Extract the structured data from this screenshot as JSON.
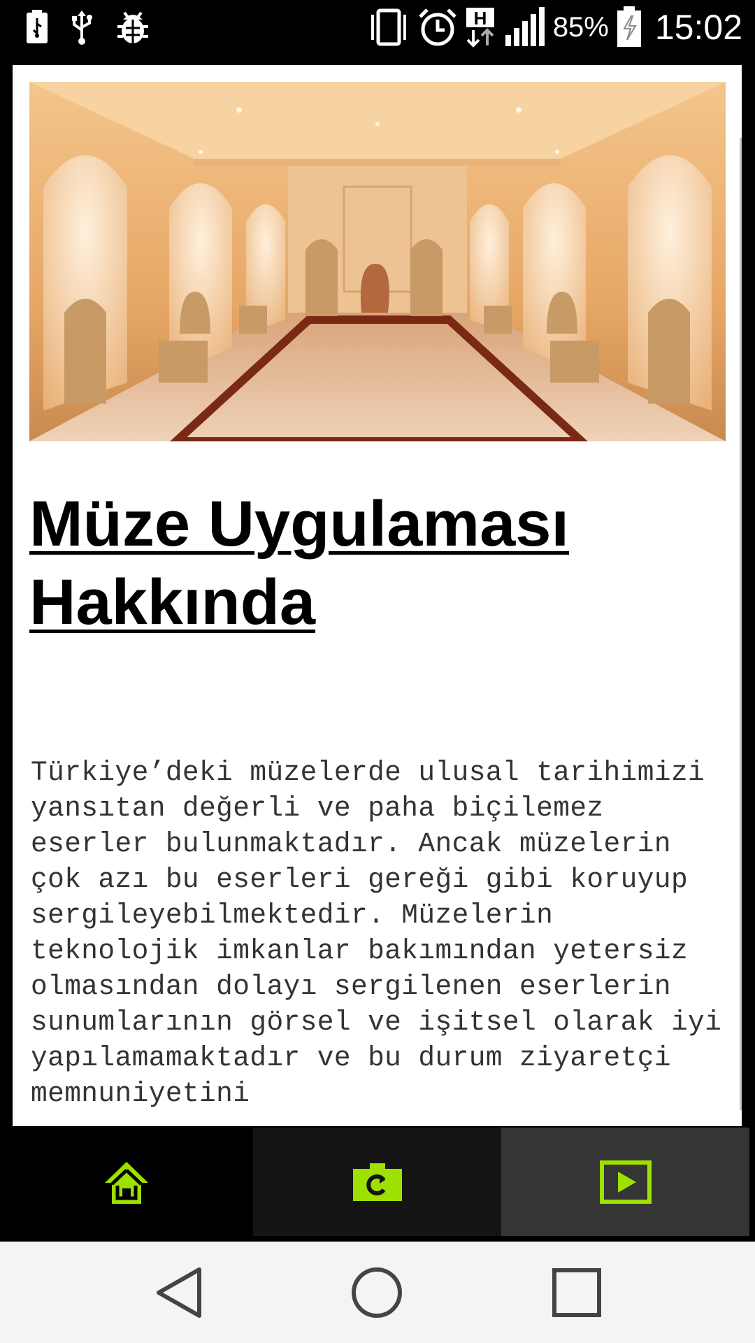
{
  "status_bar": {
    "battery_percent": "85%",
    "time": "15:02",
    "network_type": "H",
    "icons": [
      "usb-storage-icon",
      "usb-icon",
      "debug-bug-icon",
      "vibrate-icon",
      "alarm-icon",
      "h-network-icon",
      "signal-icon",
      "battery-icon"
    ]
  },
  "hero_image": {
    "description_icon": "museum-hall-photo"
  },
  "page": {
    "title": "Müze Uygulaması Hakkında",
    "body": "Türkiye’deki müzelerde ulusal tarihimizi yansıtan değerli ve paha biçilemez eserler bulunmaktadır. Ancak müzelerin çok azı bu eserleri gereği gibi koruyup sergileyebilmektedir. Müzelerin teknolojik imkanlar bakımından yetersiz olmasından dolayı sergilenen eserlerin sunumlarının görsel ve işitsel olarak iyi yapılamamaktadır ve bu durum ziyaretçi memnuniyetini"
  },
  "tabs": [
    {
      "icon": "home-icon"
    },
    {
      "icon": "camera-switch-icon"
    },
    {
      "icon": "play-video-icon"
    }
  ],
  "colors": {
    "accent": "#9ee000",
    "tab_home_bg": "#000000",
    "tab_camera_bg": "#141414",
    "tab_video_bg": "#353535",
    "navbar_bg": "#f4f4f4"
  },
  "nav": [
    "back-icon",
    "home-circle-icon",
    "recents-icon"
  ]
}
